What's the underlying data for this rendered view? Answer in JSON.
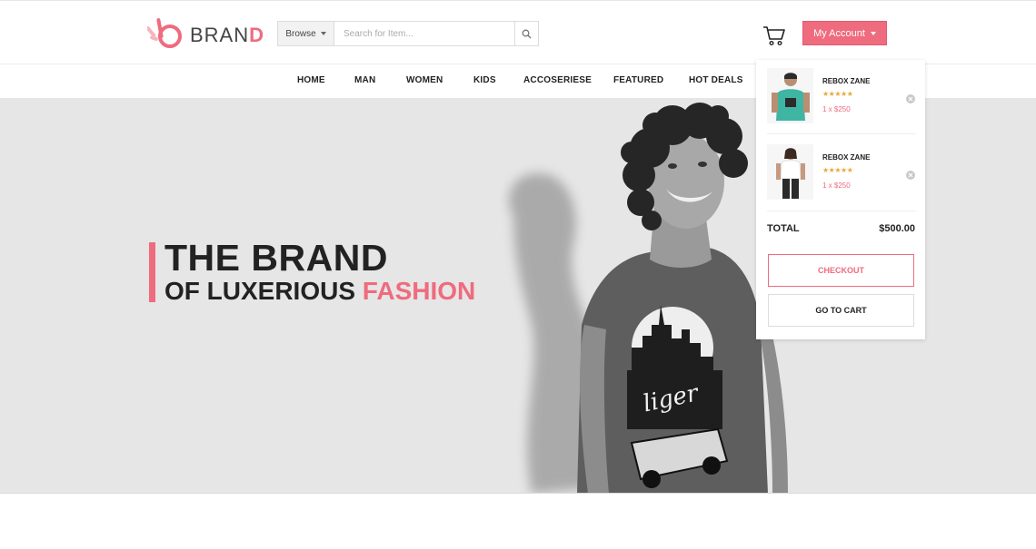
{
  "brand": {
    "text": "BRAN",
    "accent": "D"
  },
  "search": {
    "browse_label": "Browse",
    "placeholder": "Search for Item..."
  },
  "account": {
    "label": "My Account"
  },
  "nav": {
    "items": [
      "HOME",
      "MAN",
      "WOMEN",
      "KIDS",
      "ACCOSERIESE",
      "FEATURED",
      "HOT DEALS"
    ]
  },
  "hero": {
    "title": "THE BRAND",
    "subtitle_prefix": "OF LUXERIOUS ",
    "subtitle_highlight": "FASHION"
  },
  "cart": {
    "items": [
      {
        "name": "REBOX ZANE",
        "stars": "★★★★★",
        "qty_price": "1 x  $250"
      },
      {
        "name": "REBOX ZANE",
        "stars": "★★★★★",
        "qty_price": "1 x  $250"
      }
    ],
    "total_label": "TOTAL",
    "total_value": "$500.00",
    "checkout_label": "CHECKOUT",
    "gotocart_label": "GO TO CART"
  },
  "colors": {
    "accent": "#ef6b7e",
    "hero_bg": "#e6e6e6",
    "star": "#e8a93a"
  },
  "icons": [
    "logo-icon",
    "search-icon",
    "cart-icon",
    "chevron-down-icon",
    "remove-icon"
  ]
}
